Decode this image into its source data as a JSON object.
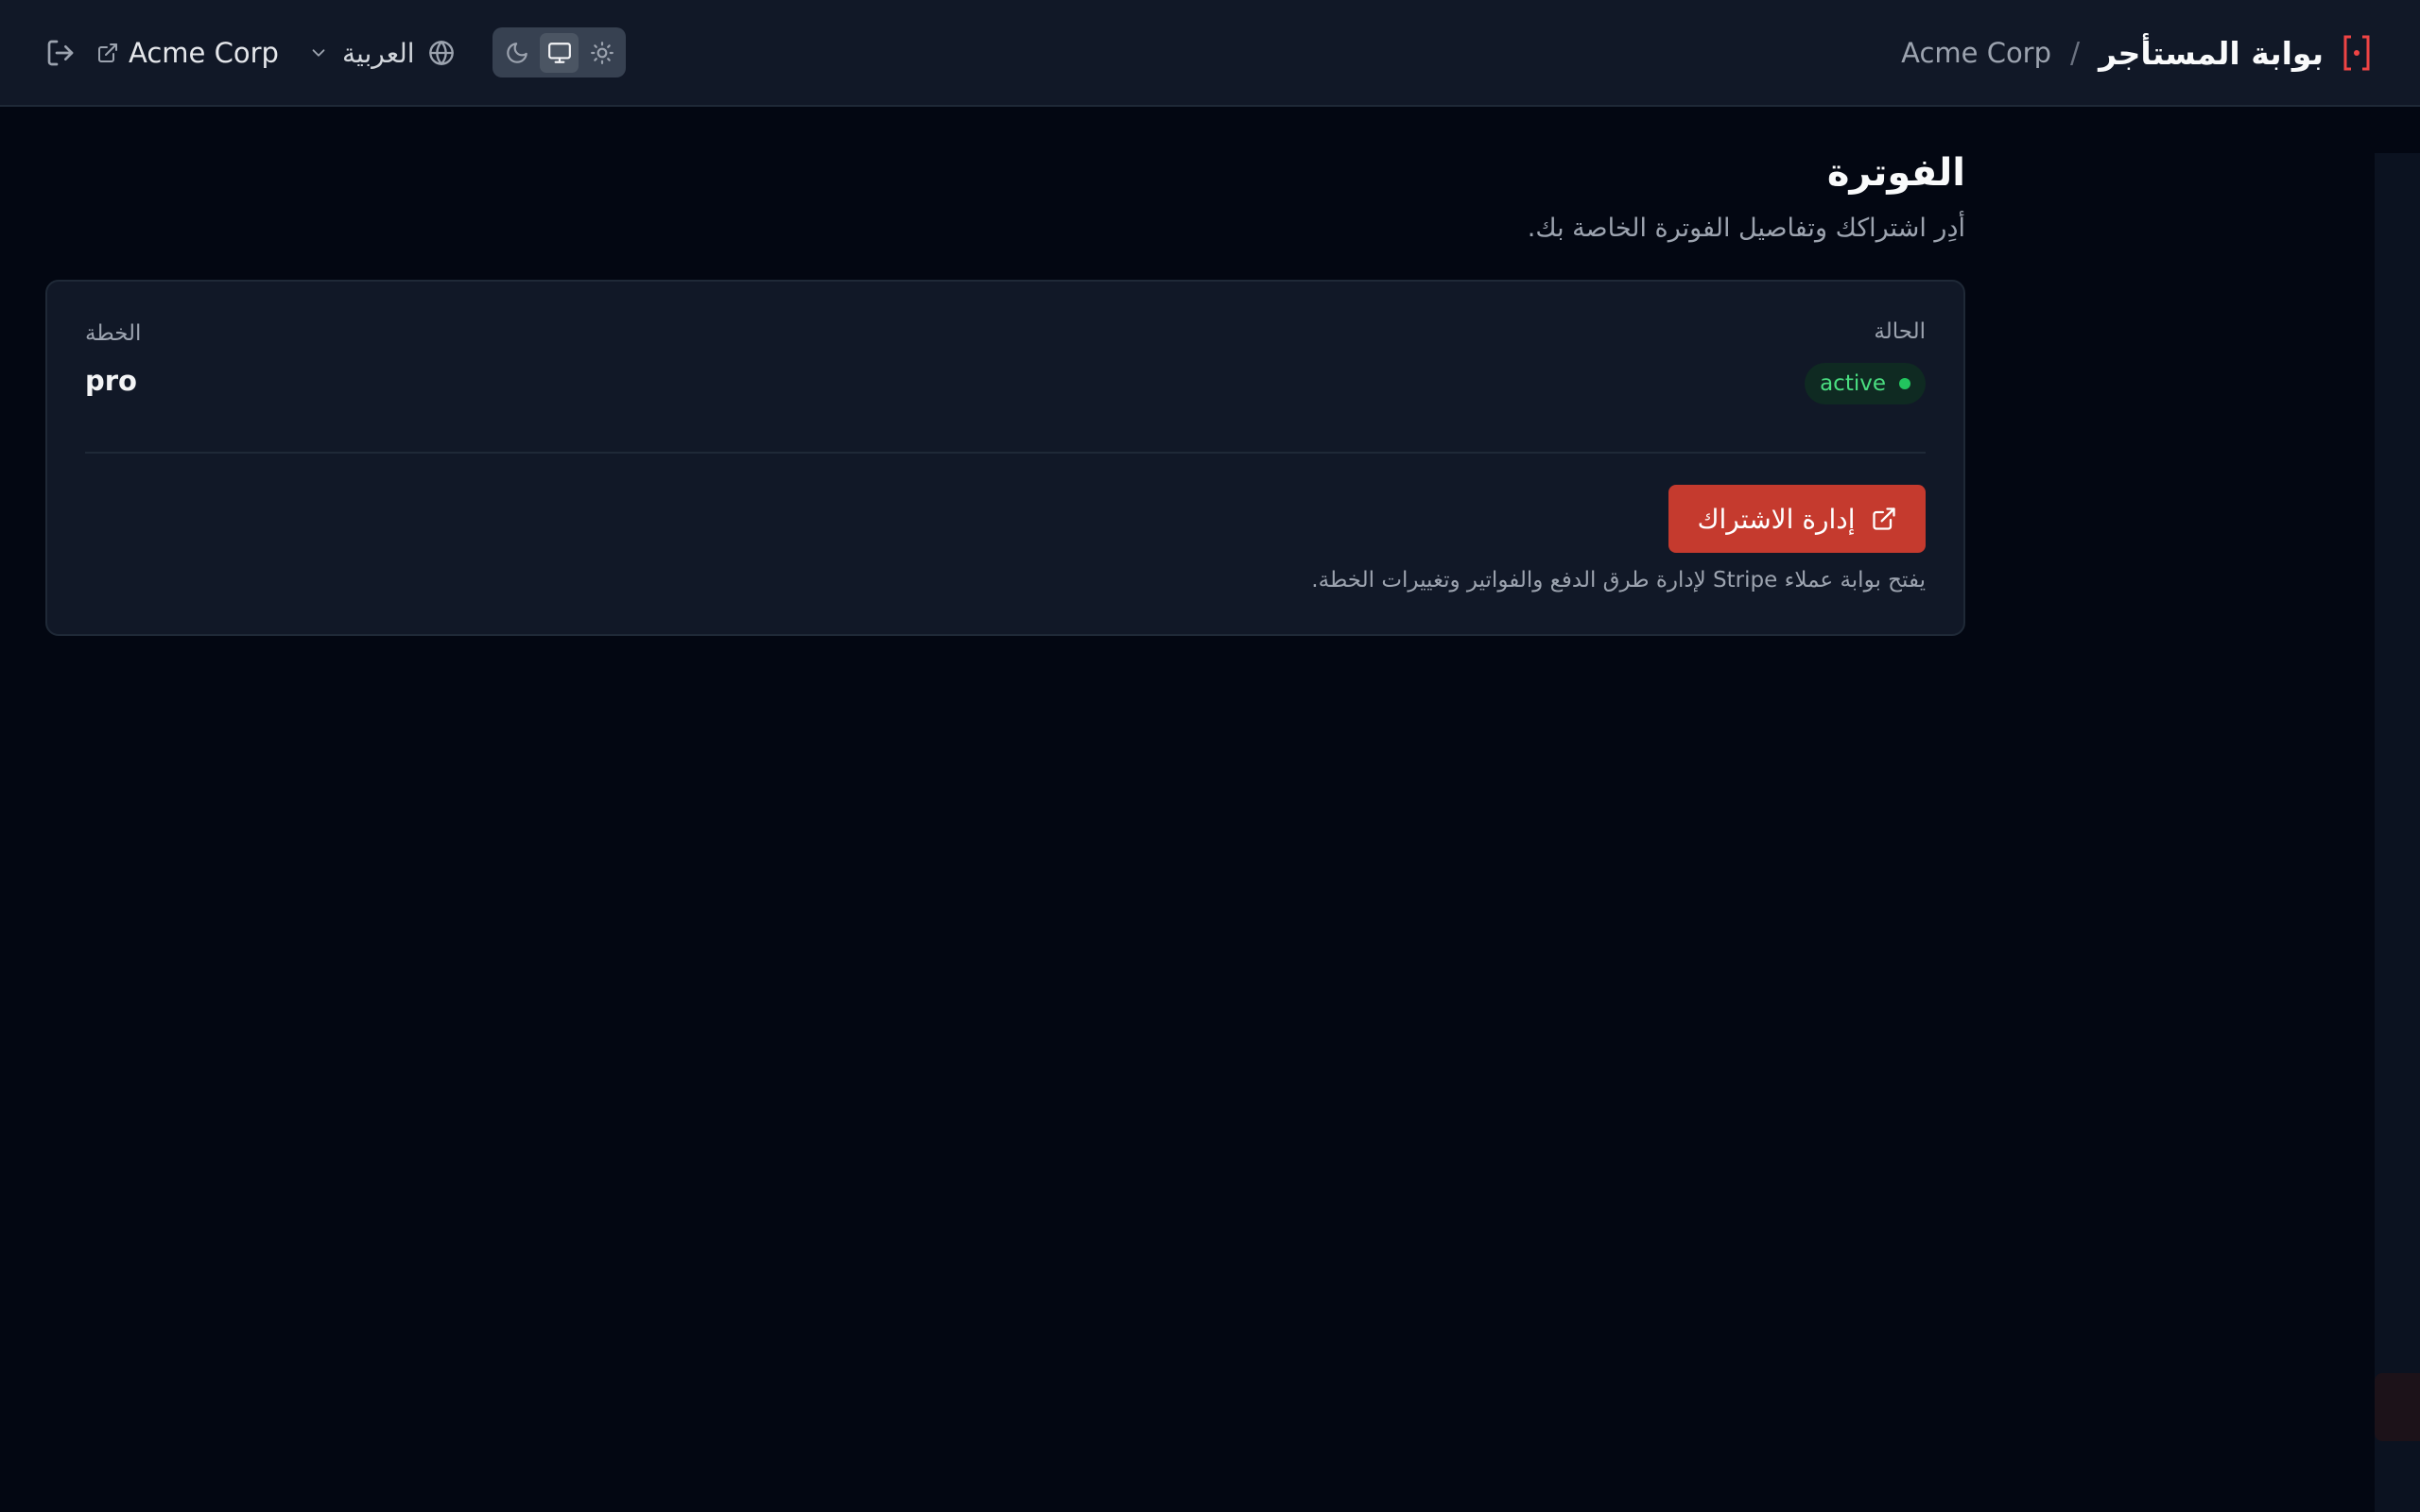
{
  "header": {
    "brand_title": "بوابة المستأجر",
    "separator": "/",
    "tenant_name": "Acme Corp",
    "tenant_link_label": "Acme Corp",
    "language_label": "العربية",
    "icons": {
      "brand": "bracket-dot-icon",
      "logout": "logout-icon",
      "external_link": "external-link-icon",
      "language": "globe-icon",
      "language_dropdown": "chevron-down-icon",
      "theme_dark": "moon-icon",
      "theme_system": "monitor-icon",
      "theme_light": "sun-icon"
    },
    "theme_selected": "system"
  },
  "page": {
    "title": "الفوترة",
    "subtitle": "أدِر اشتراكك وتفاصيل الفوترة الخاصة بك."
  },
  "billing": {
    "status_label": "الحالة",
    "status_value": "active",
    "plan_label": "الخطة",
    "plan_value": "pro",
    "manage_button_label": "إدارة الاشتراك",
    "manage_hint": "يفتح بوابة عملاء Stripe لإدارة طرق الدفع والفواتير وتغييرات الخطة."
  },
  "colors": {
    "background": "#030712",
    "surface": "#111827",
    "border": "#1f2937",
    "accent": "#c53a2e",
    "status_active": "#22c55e"
  }
}
